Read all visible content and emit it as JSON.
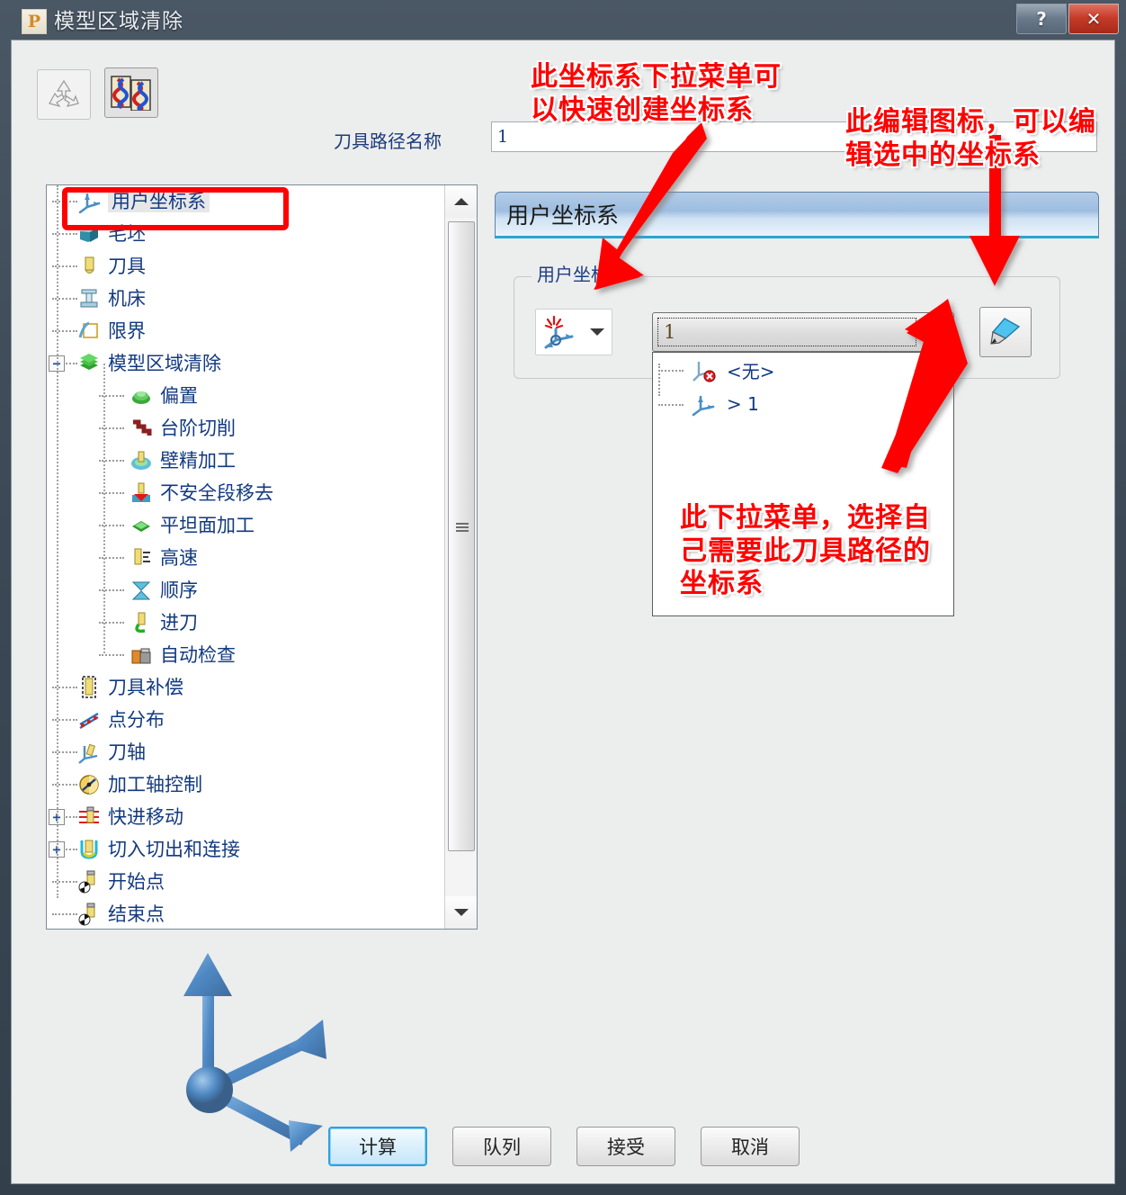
{
  "window": {
    "title": "模型区域清除",
    "app_icon": "P",
    "help_label": "?",
    "close_label": "✕"
  },
  "toolbar": {
    "buttons": [
      {
        "name": "recycle-icon",
        "label": ""
      },
      {
        "name": "toolpath-preview-icon",
        "label": ""
      }
    ]
  },
  "toolpath": {
    "label": "刀具路径名称",
    "value": "1",
    "placeholder": ""
  },
  "tree": {
    "items": [
      {
        "label": "用户坐标系",
        "level": 0,
        "icon": "axes-icon",
        "selected": true
      },
      {
        "label": "毛坯",
        "level": 0,
        "icon": "block-icon"
      },
      {
        "label": "刀具",
        "level": 0,
        "icon": "tool-icon"
      },
      {
        "label": "机床",
        "level": 0,
        "icon": "machine-icon"
      },
      {
        "label": "限界",
        "level": 0,
        "icon": "limit-icon"
      },
      {
        "label": "模型区域清除",
        "level": 0,
        "icon": "layers-icon",
        "expander": "−"
      },
      {
        "label": "偏置",
        "level": 1,
        "icon": "offset-icon"
      },
      {
        "label": "台阶切削",
        "level": 1,
        "icon": "step-cut-icon"
      },
      {
        "label": "壁精加工",
        "level": 1,
        "icon": "wall-finish-icon"
      },
      {
        "label": "不安全段移去",
        "level": 1,
        "icon": "unsafe-remove-icon"
      },
      {
        "label": "平坦面加工",
        "level": 1,
        "icon": "flat-face-icon"
      },
      {
        "label": "高速",
        "level": 1,
        "icon": "high-speed-icon"
      },
      {
        "label": "顺序",
        "level": 1,
        "icon": "order-icon"
      },
      {
        "label": "进刀",
        "level": 1,
        "icon": "plunge-icon"
      },
      {
        "label": "自动检查",
        "level": 1,
        "icon": "auto-check-icon"
      },
      {
        "label": "刀具补偿",
        "level": 0,
        "icon": "tool-comp-icon"
      },
      {
        "label": "点分布",
        "level": 0,
        "icon": "point-dist-icon"
      },
      {
        "label": "刀轴",
        "level": 0,
        "icon": "tool-axis-icon"
      },
      {
        "label": "加工轴控制",
        "level": 0,
        "icon": "machine-axis-icon"
      },
      {
        "label": "快进移动",
        "level": 0,
        "icon": "rapid-move-icon",
        "expander": "+"
      },
      {
        "label": "切入切出和连接",
        "level": 0,
        "icon": "lead-link-icon",
        "expander": "+"
      },
      {
        "label": "开始点",
        "level": 0,
        "icon": "start-point-icon"
      },
      {
        "label": "结束点",
        "level": 0,
        "icon": "end-point-icon"
      }
    ],
    "scroll_up": "▲",
    "scroll_down": "▼"
  },
  "panel": {
    "header": "用户坐标系",
    "group_title": "用户坐标系",
    "create_button_icon": "create-workplane-icon",
    "create_button_arrow": "▼",
    "combo_value": "1",
    "combo_arrow": "▼",
    "edit_button_icon": "pencil-edit-icon",
    "dropdown_items": [
      {
        "label": "<无>",
        "icon": "no-workplane-icon"
      },
      {
        "label": "> 1",
        "icon": "workplane-icon"
      }
    ]
  },
  "footer": {
    "buttons": [
      {
        "label": "计算",
        "default": true
      },
      {
        "label": "队列",
        "default": false
      },
      {
        "label": "接受",
        "default": false
      },
      {
        "label": "取消",
        "default": false
      }
    ]
  },
  "annotations": [
    {
      "id": "anno1",
      "text": "此坐标系下拉菜单可以快速创建坐标系"
    },
    {
      "id": "anno2",
      "text": "此编辑图标，可以编辑选中的坐标系"
    },
    {
      "id": "anno3",
      "text": "此下拉菜单，选择自己需要此刀具路径的坐标系"
    }
  ],
  "colors": {
    "annotation_red": "#ff0000",
    "panel_header_blue": "#9dbde0",
    "accent_cyan": "#2aa6cd",
    "tree_text_blue": "#123a80"
  }
}
